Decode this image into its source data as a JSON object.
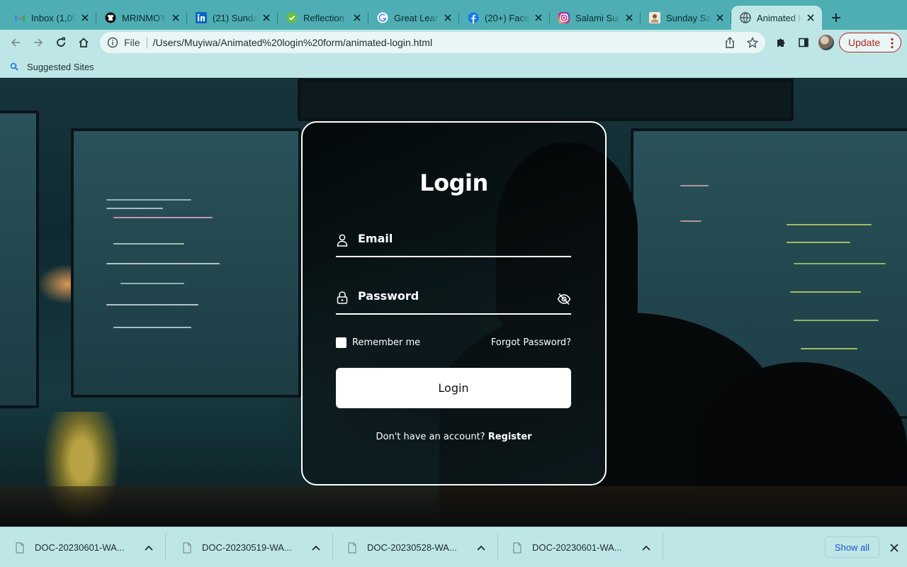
{
  "browser": {
    "tabs": [
      {
        "title": "Inbox (1,09",
        "icon": "gmail-icon",
        "accent": "#ea4335"
      },
      {
        "title": "MRINMOY",
        "icon": "github-icon",
        "accent": "#111111"
      },
      {
        "title": "(21) Sunda",
        "icon": "linkedin-icon",
        "accent": "#0a66c2"
      },
      {
        "title": "Reflection",
        "icon": "check-circle-icon",
        "accent": "#6abf3b"
      },
      {
        "title": "Great Learn",
        "icon": "google-icon",
        "accent": "#4285f4"
      },
      {
        "title": "(20+) Face",
        "icon": "facebook-icon",
        "accent": "#1877f2"
      },
      {
        "title": "Salami Sun",
        "icon": "instagram-icon",
        "accent": "#d6249f"
      },
      {
        "title": "Sunday Sa",
        "icon": "profile-photo-icon",
        "accent": "#c49a6c"
      },
      {
        "title": "Animated lo",
        "icon": "globe-icon",
        "accent": "#3c4b4c",
        "active": true
      }
    ],
    "address_bar": {
      "scheme_label": "File",
      "url": "/Users/Muyiwa/Animated%20login%20form/animated-login.html"
    },
    "update_label": "Update",
    "bookmarks": [
      {
        "label": "Suggested Sites",
        "icon": "search-icon"
      }
    ]
  },
  "page": {
    "title": "Login",
    "email_label": "Email",
    "password_label": "Password",
    "remember_label": "Remember me",
    "forgot_label": "Forgot Password?",
    "login_button": "Login",
    "register_prompt": "Don't have an account?",
    "register_link": "Register"
  },
  "downloads": {
    "items": [
      {
        "name": "DOC-20230601-WA..."
      },
      {
        "name": "DOC-20230519-WA..."
      },
      {
        "name": "DOC-20230528-WA..."
      },
      {
        "name": "DOC-20230601-WA..."
      }
    ],
    "show_all_label": "Show all"
  },
  "colors": {
    "chrome": "#bfe6e6",
    "tabstrip": "#4eaeb3",
    "update_accent": "#b3261e",
    "link_blue": "#1a57c9"
  }
}
